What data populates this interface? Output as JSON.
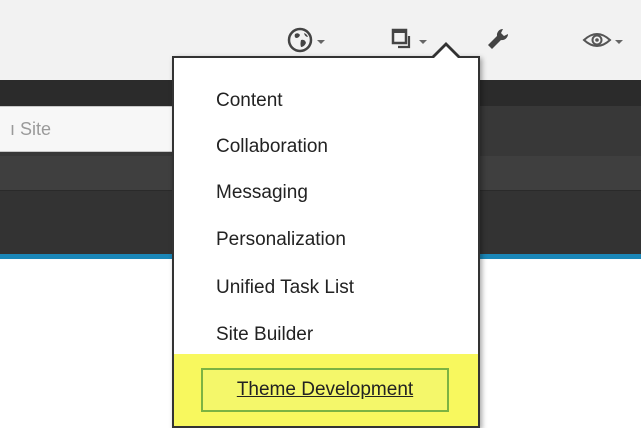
{
  "toolbar": {
    "buttons": [
      {
        "icon": "globe-icon"
      },
      {
        "icon": "windows-icon"
      },
      {
        "icon": "wrench-icon"
      },
      {
        "icon": "eye-icon"
      }
    ]
  },
  "header": {
    "search_placeholder_fragment": "ı Site"
  },
  "menu": {
    "items": [
      {
        "label": "Content"
      },
      {
        "label": "Collaboration"
      },
      {
        "label": "Messaging"
      },
      {
        "label": "Personalization"
      },
      {
        "label": "Unified Task List"
      },
      {
        "label": "Site Builder"
      },
      {
        "label": "Theme Development",
        "highlighted": true
      }
    ]
  },
  "colors": {
    "accent": "#1b87b8",
    "highlight": "#f8f85e",
    "highlight_border": "#7cb342",
    "header_dark": "#383838"
  }
}
